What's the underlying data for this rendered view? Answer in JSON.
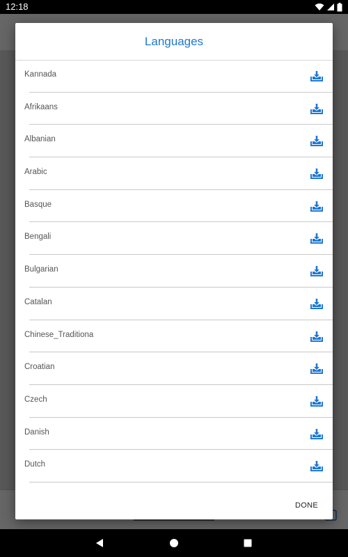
{
  "status_bar": {
    "time": "12:18",
    "icons": [
      "wifi-icon",
      "signal-icon",
      "battery-icon"
    ]
  },
  "dialog": {
    "title": "Languages",
    "languages": [
      {
        "label": "Kannada",
        "icon": "download-icon"
      },
      {
        "label": "Afrikaans",
        "icon": "download-icon"
      },
      {
        "label": "Albanian",
        "icon": "download-icon"
      },
      {
        "label": "Arabic",
        "icon": "download-icon"
      },
      {
        "label": "Basque",
        "icon": "download-icon"
      },
      {
        "label": "Bengali",
        "icon": "download-icon"
      },
      {
        "label": "Bulgarian",
        "icon": "download-icon"
      },
      {
        "label": "Catalan",
        "icon": "download-icon"
      },
      {
        "label": "Chinese_Traditiona",
        "icon": "download-icon"
      },
      {
        "label": "Croatian",
        "icon": "download-icon"
      },
      {
        "label": "Czech",
        "icon": "download-icon"
      },
      {
        "label": "Danish",
        "icon": "download-icon"
      },
      {
        "label": "Dutch",
        "icon": "download-icon"
      }
    ],
    "done_label": "DONE"
  },
  "nav_bar": {
    "icons": [
      "back-icon",
      "home-icon",
      "recents-icon"
    ]
  },
  "colors": {
    "accent": "#1f78d1",
    "status_bar": "#000000",
    "scrim": "#000000"
  }
}
